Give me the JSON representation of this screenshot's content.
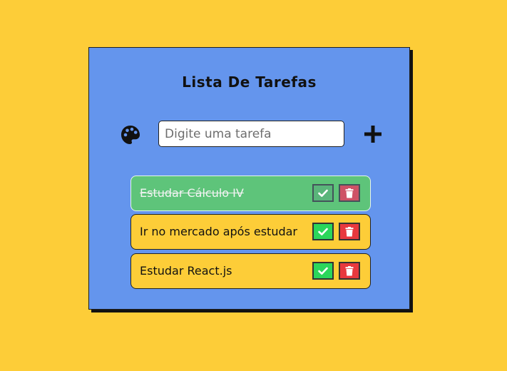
{
  "app": {
    "title": "Lista De Tarefas"
  },
  "input": {
    "placeholder": "Digite uma tarefa",
    "value": ""
  },
  "icons": {
    "theme": "palette-icon",
    "add": "plus-icon",
    "complete": "check-icon",
    "delete": "trash-icon"
  },
  "tasks": [
    {
      "text": "Estudar Cálculo IV",
      "completed": true
    },
    {
      "text": "Ir no mercado após estudar",
      "completed": false
    },
    {
      "text": "Estudar React.js",
      "completed": false
    }
  ],
  "colors": {
    "page_background": "#fdcd38",
    "card_background": "#6495ed",
    "task_background": "#fdcd38",
    "task_completed_background": "#5ec47a",
    "check_button": "#2bd65b",
    "delete_button": "#e8393e"
  }
}
